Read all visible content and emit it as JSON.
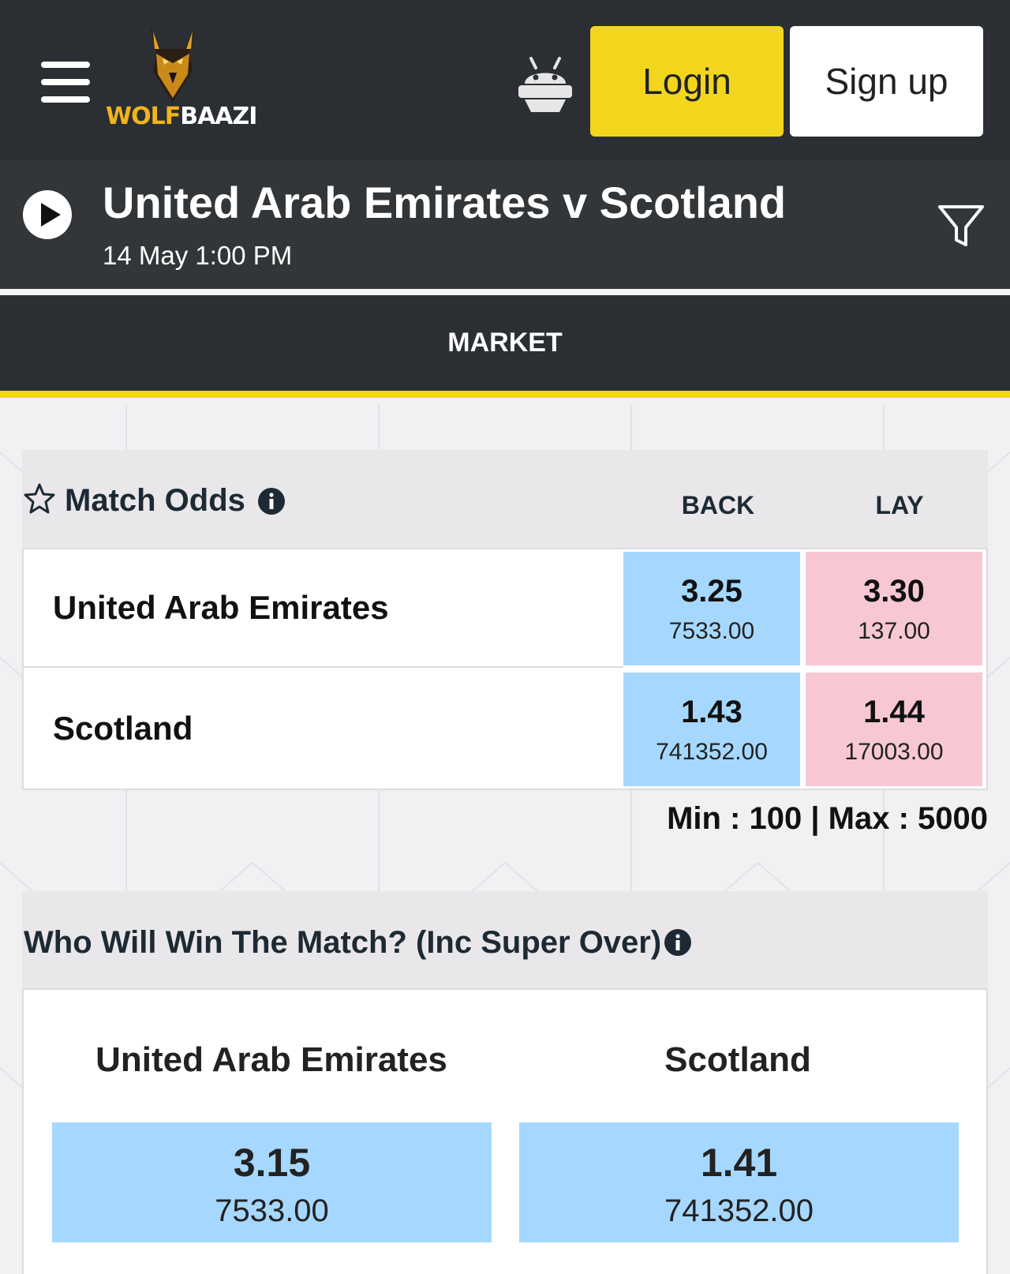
{
  "header": {
    "logo_text_part1": "WOLF",
    "logo_text_part2": "BAAZI",
    "login_label": "Login",
    "signup_label": "Sign up",
    "accent_color": "#f2d61e",
    "logo_gold": "#f2b31f"
  },
  "event": {
    "title": "United Arab Emirates v Scotland",
    "datetime": "14 May 1:00 PM"
  },
  "tabs": {
    "market_label": "MARKET"
  },
  "match_odds": {
    "title": "Match Odds",
    "back_label": "BACK",
    "lay_label": "LAY",
    "runners": [
      {
        "name": "United Arab Emirates",
        "back_price": "3.25",
        "back_size": "7533.00",
        "lay_price": "3.30",
        "lay_size": "137.00"
      },
      {
        "name": "Scotland",
        "back_price": "1.43",
        "back_size": "741352.00",
        "lay_price": "1.44",
        "lay_size": "17003.00"
      }
    ],
    "limits": "Min : 100 | Max : 5000",
    "back_color": "#a6d8ff",
    "lay_color": "#f7c8d4"
  },
  "who_will_win": {
    "title": "Who Will Win The Match? (Inc Super Over)",
    "runners": [
      {
        "name": "United Arab Emirates",
        "price": "3.15",
        "size": "7533.00"
      },
      {
        "name": "Scotland",
        "price": "1.41",
        "size": "741352.00"
      }
    ]
  },
  "icons": [
    "menu-icon",
    "wolf-logo",
    "android-icon",
    "play-icon",
    "filter-icon",
    "star-icon",
    "info-icon"
  ]
}
